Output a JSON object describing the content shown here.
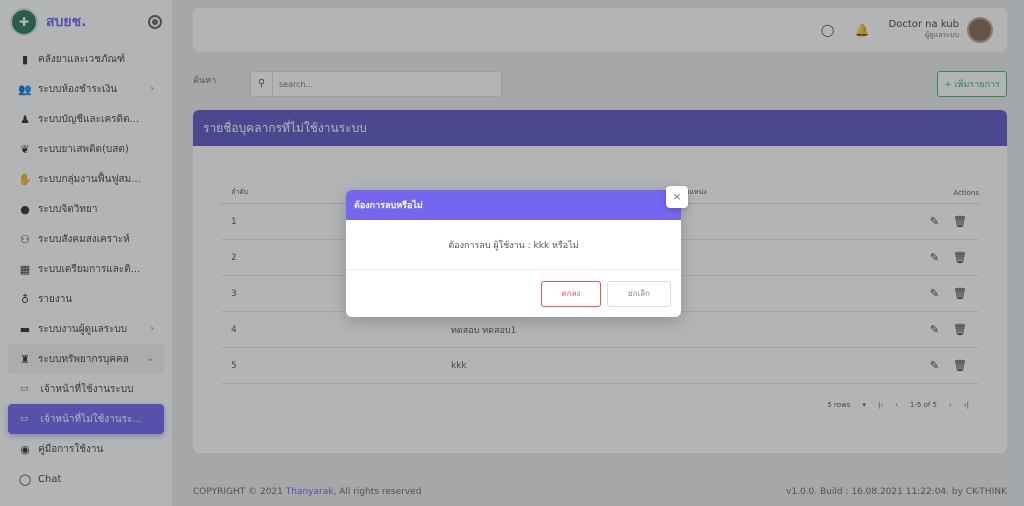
{
  "app": {
    "brand": "สบยช."
  },
  "sidebar": {
    "items": [
      {
        "label": "คลังยาและเวชภัณฑ์",
        "icon": "medicine-bottle-icon"
      },
      {
        "label": "ระบบห้องชำระเงิน",
        "icon": "people-icon",
        "has_children": true
      },
      {
        "label": "ระบบบัญชีและเครดิต...",
        "icon": "person-desk-icon"
      },
      {
        "label": "ระบบยาเสพติด(บสต)",
        "icon": "hands-heart-icon"
      },
      {
        "label": "ระบบกลุ่มงานฟื้นฟูสม...",
        "icon": "handshake-icon"
      },
      {
        "label": "ระบบจิตวิทยา",
        "icon": "head-brain-icon"
      },
      {
        "label": "ระบบสังคมสงเคราะห์",
        "icon": "group-icon"
      },
      {
        "label": "ระบบเตรียมการและติ...",
        "icon": "clipboard-icon"
      },
      {
        "label": "รายงาน",
        "icon": "report-icon"
      },
      {
        "label": "ระบบงานผู้ดูแลระบบ",
        "icon": "bed-icon",
        "has_children": true
      },
      {
        "label": "ระบบทรัพยากรบุคคล",
        "icon": "staff-icon",
        "expanded": true
      }
    ],
    "sub_items": [
      {
        "label": "เจ้าหน้าที่ใช้งานระบบ"
      },
      {
        "label": "เจ้าหน้าที่ไม่ใช้งานระ...",
        "active": true
      }
    ],
    "bottom_items": [
      {
        "label": "คู่มือการใช้งาน",
        "icon": "eye-icon"
      },
      {
        "label": "Chat",
        "icon": "chat-icon"
      }
    ]
  },
  "header": {
    "user_name": "Doctor na kub",
    "user_role": "ผู้ดูแลระบบ"
  },
  "search": {
    "label": "ค้นหา",
    "placeholder": "search..."
  },
  "add_button": "+ เพิ่มรายการ",
  "card": {
    "title": "รายชื่อบุคลากรที่ไม่ใช้งานระบบ",
    "columns": [
      "ลำดับ",
      "",
      "ตำแหน่ง",
      "Actions"
    ],
    "rows": [
      {
        "no": "1",
        "name": ""
      },
      {
        "no": "2",
        "name": ""
      },
      {
        "no": "3",
        "name": ""
      },
      {
        "no": "4",
        "name": "ทดสอบ ทดสอบ1"
      },
      {
        "no": "5",
        "name": "kkk"
      }
    ]
  },
  "pagination": {
    "rows_per_page": "5 rows",
    "range": "1-5 of 5"
  },
  "footer": {
    "copyright_prefix": "COPYRIGHT © 2021",
    "company": "Thanyarak",
    "copyright_suffix": ", All rights reserved",
    "version": "v1.0.0. Build : 16.08.2021 11:22:04. by CK-THINK"
  },
  "modal": {
    "title": "ต้องการลบหรือไม่",
    "message": "ต้องการลบ ผู้ใช้งาน : kkk หรือไม่",
    "ok_label": "ตกลง",
    "cancel_label": "ยกเลิก",
    "close_symbol": "×"
  },
  "colors": {
    "primary": "#7367f0",
    "card_header": "#625ac4",
    "success": "#28c76f",
    "danger": "#ea5455"
  }
}
